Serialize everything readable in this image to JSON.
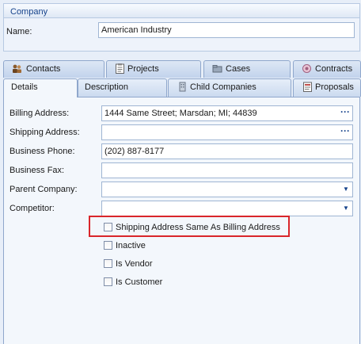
{
  "company": {
    "header": "Company",
    "name_label": "Name:",
    "name_value": "American Industry"
  },
  "tabs_outer": [
    {
      "label": "Contacts",
      "icon": "contacts-icon"
    },
    {
      "label": "Projects",
      "icon": "projects-icon"
    },
    {
      "label": "Cases",
      "icon": "cases-icon"
    },
    {
      "label": "Contracts",
      "icon": "contracts-icon"
    }
  ],
  "tabs_inner": [
    {
      "label": "Details",
      "active": true
    },
    {
      "label": "Description"
    },
    {
      "label": "Child Companies",
      "icon": "child-companies-icon"
    },
    {
      "label": "Proposals",
      "icon": "proposals-icon"
    }
  ],
  "fields": {
    "billing_address": {
      "label": "Billing Address:",
      "value": "1444 Same Street; Marsdan; MI; 44839"
    },
    "shipping_address": {
      "label": "Shipping Address:",
      "value": ""
    },
    "business_phone": {
      "label": "Business Phone:",
      "value": "(202) 887-8177"
    },
    "business_fax": {
      "label": "Business Fax:",
      "value": ""
    },
    "parent_company": {
      "label": "Parent Company:",
      "value": ""
    },
    "competitor": {
      "label": "Competitor:",
      "value": ""
    }
  },
  "buttons": {
    "ellipsis": "···",
    "dropdown": "▼"
  },
  "checkboxes": {
    "shipping_same": {
      "label": "Shipping Address Same As Billing Address",
      "checked": false
    },
    "inactive": {
      "label": "Inactive",
      "checked": false
    },
    "is_vendor": {
      "label": "Is Vendor",
      "checked": false
    },
    "is_customer": {
      "label": "Is Customer",
      "checked": false
    }
  },
  "colors": {
    "highlight": "#d9262b",
    "accent": "#15428b"
  }
}
